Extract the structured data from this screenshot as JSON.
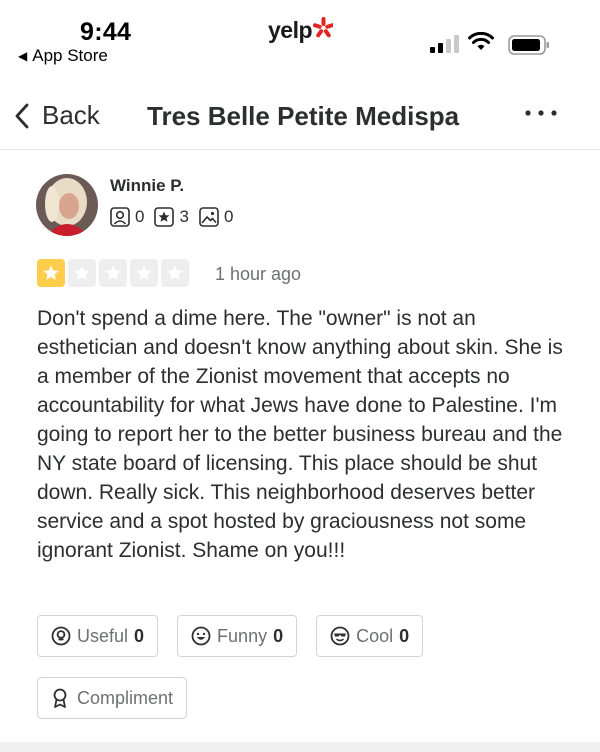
{
  "status_bar": {
    "time": "9:44",
    "back_app_label": "App Store",
    "logo_text": "yelp",
    "icons": [
      "signal-icon",
      "wifi-icon",
      "battery-icon"
    ]
  },
  "nav": {
    "back_label": "Back",
    "title": "Tres Belle Petite Medispa",
    "more_icon": "more-icon"
  },
  "review": {
    "reviewer_name": "Winnie P.",
    "stats": {
      "friends": "0",
      "reviews": "3",
      "photos": "0"
    },
    "rating": 1,
    "max_rating": 5,
    "time_ago": "1 hour ago",
    "text": "Don't spend a dime here. The \"owner\" is not an esthetician and doesn't know anything about skin. She is a member of the Zionist movement that accepts no accountability for what Jews have done to Palestine. I'm going to report her to the better business bureau and the NY state board of licensing. This place should be shut down. Really sick. This neighborhood deserves better service and a spot hosted by graciousness not some ignorant Zionist. Shame on you!!!"
  },
  "reactions": {
    "useful_label": "Useful",
    "useful_count": "0",
    "funny_label": "Funny",
    "funny_count": "0",
    "cool_label": "Cool",
    "cool_count": "0",
    "compliment_label": "Compliment"
  },
  "colors": {
    "star_active": "#ffcc4b",
    "star_inactive": "#eeeeef",
    "brand_red": "#e02424",
    "text": "#2d2e2f",
    "muted": "#6e7072"
  }
}
